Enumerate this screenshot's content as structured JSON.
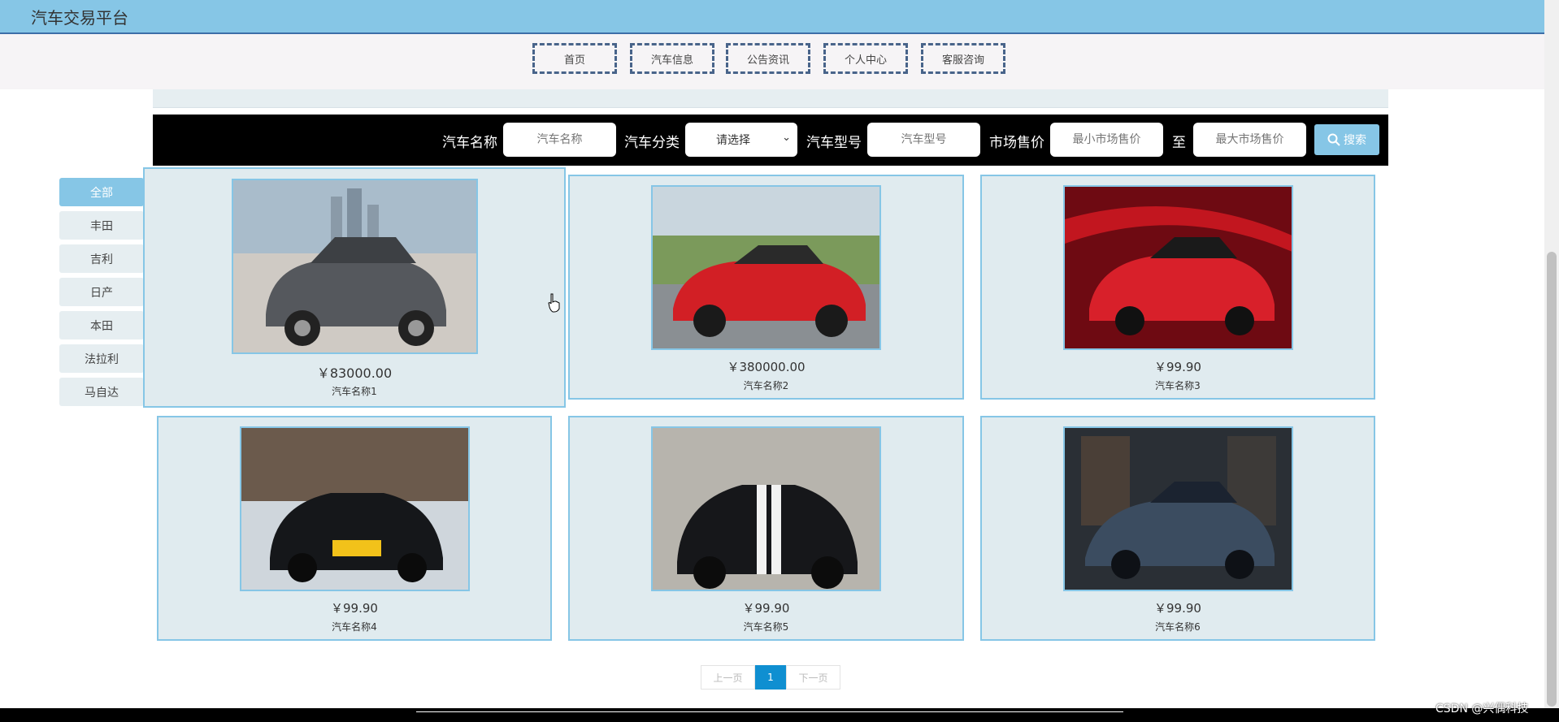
{
  "app": {
    "title": "汽车交易平台"
  },
  "nav": {
    "items": [
      {
        "label": "首页"
      },
      {
        "label": "汽车信息"
      },
      {
        "label": "公告资讯"
      },
      {
        "label": "个人中心"
      },
      {
        "label": "客服咨询"
      }
    ]
  },
  "search": {
    "name_label": "汽车名称",
    "name_placeholder": "汽车名称",
    "category_label": "汽车分类",
    "category_value": "请选择",
    "model_label": "汽车型号",
    "model_placeholder": "汽车型号",
    "price_label": "市场售价",
    "min_placeholder": "最小市场售价",
    "to_label": "至",
    "max_placeholder": "最大市场售价",
    "button_label": "搜索"
  },
  "sidebar": {
    "items": [
      {
        "label": "全部",
        "active": true
      },
      {
        "label": "丰田"
      },
      {
        "label": "吉利"
      },
      {
        "label": "日产"
      },
      {
        "label": "本田"
      },
      {
        "label": "法拉利"
      },
      {
        "label": "马自达"
      }
    ]
  },
  "products": [
    {
      "price": "￥83000.00",
      "name": "汽车名称1",
      "image": "gray-sedan"
    },
    {
      "price": "￥380000.00",
      "name": "汽车名称2",
      "image": "red-sports-car"
    },
    {
      "price": "￥99.90",
      "name": "汽车名称3",
      "image": "red-suv"
    },
    {
      "price": "￥99.90",
      "name": "汽车名称4",
      "image": "black-sedan-showroom"
    },
    {
      "price": "￥99.90",
      "name": "汽车名称5",
      "image": "black-muscle-car"
    },
    {
      "price": "￥99.90",
      "name": "汽车名称6",
      "image": "blue-sedan"
    }
  ],
  "pager": {
    "prev": "上一页",
    "current": "1",
    "next": "下一页"
  },
  "watermark": "CSDN @兴偶科技",
  "colors": {
    "accent": "#86c6e6",
    "nav_border": "#48648a",
    "pager_active": "#0f8fd1"
  }
}
